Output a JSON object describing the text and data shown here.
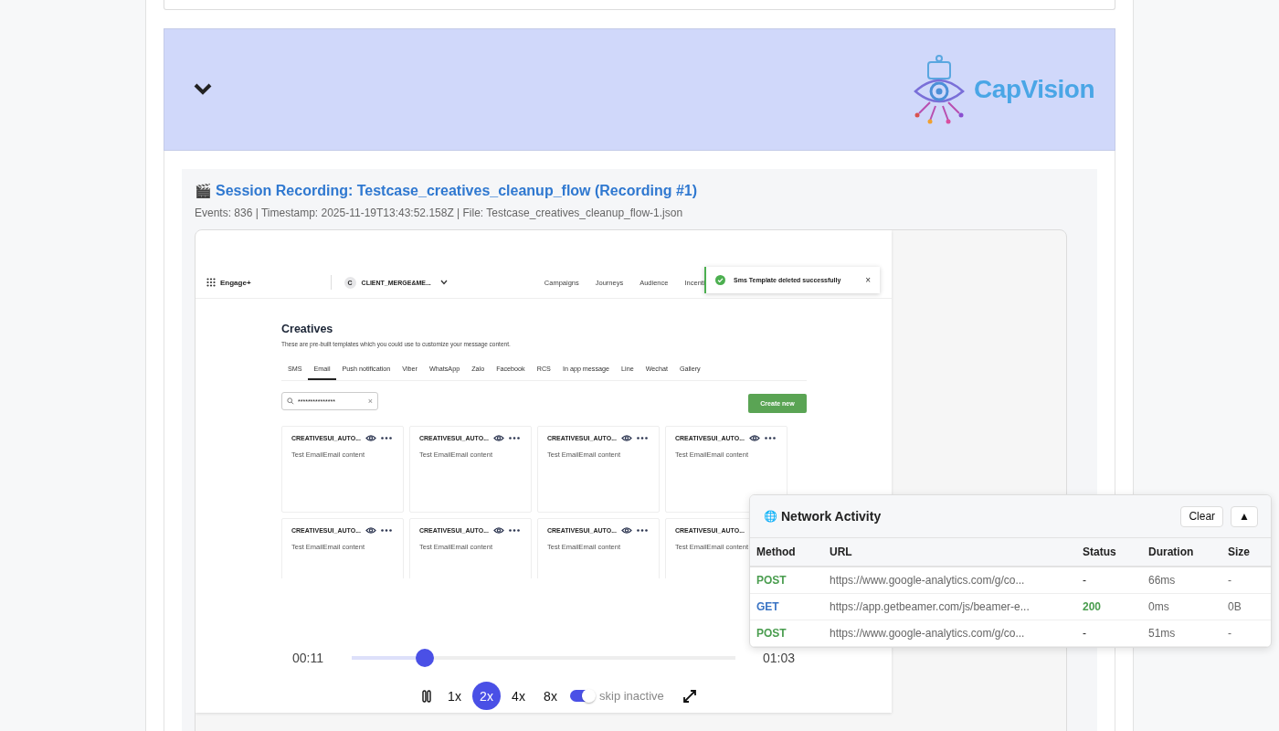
{
  "banner": {
    "expanded": true,
    "logo_text": "CapVision"
  },
  "recording": {
    "icon": "🎬",
    "title": "Session Recording: Testcase_creatives_cleanup_flow (Recording #1)",
    "meta": "Events: 836 | Timestamp: 2025-11-19T13:43:52.158Z | File: Testcase_creatives_cleanup_flow-1.json"
  },
  "app": {
    "brand": "Engage+",
    "client_initial": "C",
    "client": "CLIENT_MERGE&ME...",
    "nav": [
      "Campaigns",
      "Journeys",
      "Audience",
      "Incenti"
    ],
    "toast": {
      "message": "Sms Template deleted successfully",
      "close": "×"
    },
    "heading": "Creatives",
    "subtitle": "These are pre-built templates which you could use to customize your message content.",
    "tabs": [
      {
        "label": "SMS",
        "selected": false
      },
      {
        "label": "Email",
        "selected": true
      },
      {
        "label": "Push notification",
        "selected": false
      },
      {
        "label": "Viber",
        "selected": false
      },
      {
        "label": "WhatsApp",
        "selected": false
      },
      {
        "label": "Zalo",
        "selected": false
      },
      {
        "label": "Facebook",
        "selected": false
      },
      {
        "label": "RCS",
        "selected": false
      },
      {
        "label": "In app message",
        "selected": false
      },
      {
        "label": "Line",
        "selected": false
      },
      {
        "label": "Wechat",
        "selected": false
      },
      {
        "label": "Gallery",
        "selected": false
      }
    ],
    "search": {
      "value": "***************",
      "clear": "×"
    },
    "create_button": "Create new",
    "cards": [
      {
        "title": "CREATIVESUI_AUTO...",
        "body": "Test EmailEmail content"
      },
      {
        "title": "CREATIVESUI_AUTO...",
        "body": "Test EmailEmail content"
      },
      {
        "title": "CREATIVESUI_AUTO...",
        "body": "Test EmailEmail content"
      },
      {
        "title": "CREATIVESUI_AUTO...",
        "body": "Test EmailEmail content"
      },
      {
        "title": "CREATIVESUI_AUTO...",
        "body": "Test EmailEmail content"
      },
      {
        "title": "CREATIVESUI_AUTO...",
        "body": "Test EmailEmail content"
      },
      {
        "title": "CREATIVESUI_AUTO...",
        "body": "Test EmailEmail content"
      },
      {
        "title": "CREATIVESUI_AUTO...",
        "body": "Test EmailEmail content"
      }
    ]
  },
  "player": {
    "current": "00:11",
    "total": "01:03",
    "level": 0.19,
    "speeds": [
      {
        "label": "1x",
        "selected": false
      },
      {
        "label": "2x",
        "selected": true
      },
      {
        "label": "4x",
        "selected": false
      },
      {
        "label": "8x",
        "selected": false
      }
    ],
    "skip_inactive": {
      "label": "skip inactive",
      "on": true
    }
  },
  "network": {
    "icon": "🌐",
    "title": "Network Activity",
    "clear": "Clear",
    "collapse": "▲",
    "columns": [
      "Method",
      "URL",
      "Status",
      "Duration",
      "Size"
    ],
    "rows": [
      {
        "method": "POST",
        "color": "#4a9d4f",
        "url": "https://www.google-analytics.com/g/co...",
        "status": "-",
        "status_ok": false,
        "duration": "66ms",
        "size": "-"
      },
      {
        "method": "GET",
        "color": "#3a74c4",
        "url": "https://app.getbeamer.com/js/beamer-e...",
        "status": "200",
        "status_ok": true,
        "duration": "0ms",
        "size": "0B"
      },
      {
        "method": "POST",
        "color": "#4a9d4f",
        "url": "https://www.google-analytics.com/g/co...",
        "status": "-",
        "status_ok": false,
        "duration": "51ms",
        "size": "-"
      }
    ]
  }
}
